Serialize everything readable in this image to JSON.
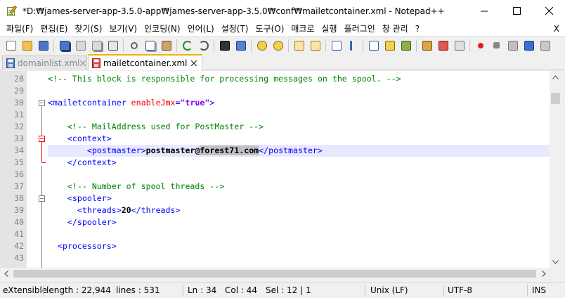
{
  "window": {
    "title": "*D:₩james-server-app-3.5.0-app₩james-server-app-3.5.0₩conf₩mailetcontainer.xml - Notepad++",
    "minimize_glyph": "—",
    "close_glyph": "✕"
  },
  "menu": {
    "items": [
      "파일(F)",
      "편집(E)",
      "찾기(S)",
      "보기(V)",
      "인코딩(N)",
      "언어(L)",
      "설정(T)",
      "도구(O)",
      "매크로",
      "실행",
      "플러그인",
      "창 관리",
      "?"
    ],
    "close_x": "X"
  },
  "toolbar": {
    "icons": [
      "new-file-icon",
      "open-file-icon",
      "save-icon",
      "save-all-icon",
      "close-icon",
      "close-all-icon",
      "print-icon",
      "cut-icon",
      "copy-icon",
      "paste-icon",
      "undo-icon",
      "redo-icon",
      "find-icon",
      "replace-icon",
      "zoom-in-icon",
      "zoom-out-icon",
      "sync-vertical-icon",
      "sync-horizontal-icon",
      "word-wrap-icon",
      "all-chars-icon",
      "indent-guide-icon",
      "lang-define-icon",
      "doc-map-icon",
      "function-list-icon",
      "folder-as-workspace-icon",
      "monitoring-icon",
      "record-macro-icon",
      "stop-macro-icon",
      "play-macro-icon",
      "play-multiple-icon",
      "save-macro-icon"
    ]
  },
  "tabs": [
    {
      "label": "domainlist.xml",
      "active": false
    },
    {
      "label": "mailetcontainer.xml",
      "active": true
    }
  ],
  "editor": {
    "current_line": 34,
    "lines": [
      {
        "n": "28",
        "tokens": [
          {
            "t": "<!-- This block is responsible for processing messages on the spool. -->",
            "c": "comment"
          }
        ]
      },
      {
        "n": "29",
        "tokens": []
      },
      {
        "n": "30",
        "tokens": [
          {
            "t": "<mailetcontainer ",
            "c": "tag"
          },
          {
            "t": "enableJmx",
            "c": "attr"
          },
          {
            "t": "=",
            "c": "tag"
          },
          {
            "t": "\"true\"",
            "c": "val"
          },
          {
            "t": ">",
            "c": "tag"
          }
        ]
      },
      {
        "n": "31",
        "tokens": []
      },
      {
        "n": "32",
        "tokens": [
          {
            "t": "    <!-- MailAddress used for PostMaster -->",
            "c": "comment"
          }
        ]
      },
      {
        "n": "33",
        "tokens": [
          {
            "t": "    <context>",
            "c": "tag"
          }
        ]
      },
      {
        "n": "34",
        "tokens": [
          {
            "t": "        <postmaster>",
            "c": "tag"
          },
          {
            "t": "postmaster@",
            "c": "text"
          },
          {
            "t": "forest71.com",
            "c": "text sel"
          },
          {
            "t": "</postmaster>",
            "c": "tag"
          }
        ]
      },
      {
        "n": "35",
        "tokens": [
          {
            "t": "    </context>",
            "c": "tag"
          }
        ]
      },
      {
        "n": "36",
        "tokens": []
      },
      {
        "n": "37",
        "tokens": [
          {
            "t": "    <!-- Number of spool threads -->",
            "c": "comment"
          }
        ]
      },
      {
        "n": "38",
        "tokens": [
          {
            "t": "    <spooler>",
            "c": "tag"
          }
        ]
      },
      {
        "n": "39",
        "tokens": [
          {
            "t": "      <threads>",
            "c": "tag"
          },
          {
            "t": "20",
            "c": "text"
          },
          {
            "t": "</threads>",
            "c": "tag"
          }
        ]
      },
      {
        "n": "40",
        "tokens": [
          {
            "t": "    </spooler>",
            "c": "tag"
          }
        ]
      },
      {
        "n": "41",
        "tokens": []
      },
      {
        "n": "42",
        "tokens": [
          {
            "t": "  <processors>",
            "c": "tag"
          }
        ]
      },
      {
        "n": "43",
        "tokens": []
      }
    ]
  },
  "status": {
    "type": "eXtensible",
    "length": "length : 22,944",
    "lines": "lines : 531",
    "ln": "Ln : 34",
    "col": "Col : 44",
    "sel": "Sel : 12 | 1",
    "eol": "Unix (LF)",
    "encoding": "UTF-8",
    "mode": "INS"
  },
  "colors": {
    "comment": "#008000",
    "tag": "#0000ff",
    "attr": "#ff0000",
    "value": "#8000ff",
    "current_line": "#e8e8ff",
    "active_tab_accent": "#f4b300"
  }
}
